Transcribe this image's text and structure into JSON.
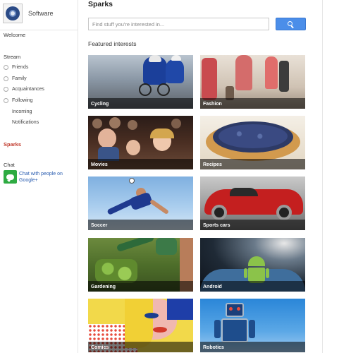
{
  "sidebar": {
    "profile_name": "Software",
    "welcome": "Welcome",
    "stream": "Stream",
    "stream_items": [
      "Friends",
      "Family",
      "Acquaintances",
      "Following"
    ],
    "incoming": "Incoming",
    "notifications": "Notifications",
    "sparks": "Sparks",
    "chat": "Chat",
    "chat_link": "Chat with people on Google+"
  },
  "main": {
    "title": "Sparks",
    "search_placeholder": "Find stuff you're interested in...",
    "featured_heading": "Featured interests",
    "interests": [
      "Cycling",
      "Fashion",
      "Movies",
      "Recipes",
      "Soccer",
      "Sports cars",
      "Gardening",
      "Android",
      "Comics",
      "Robotics"
    ]
  },
  "colors": {
    "accent_blue": "#4b8ee9",
    "sparks_red": "#c0392b",
    "chat_green": "#2eab42",
    "link_blue": "#2a5db0"
  },
  "icons": {
    "profile": "avatar-icon",
    "search": "search-icon",
    "chat": "chat-bubble-icon"
  }
}
